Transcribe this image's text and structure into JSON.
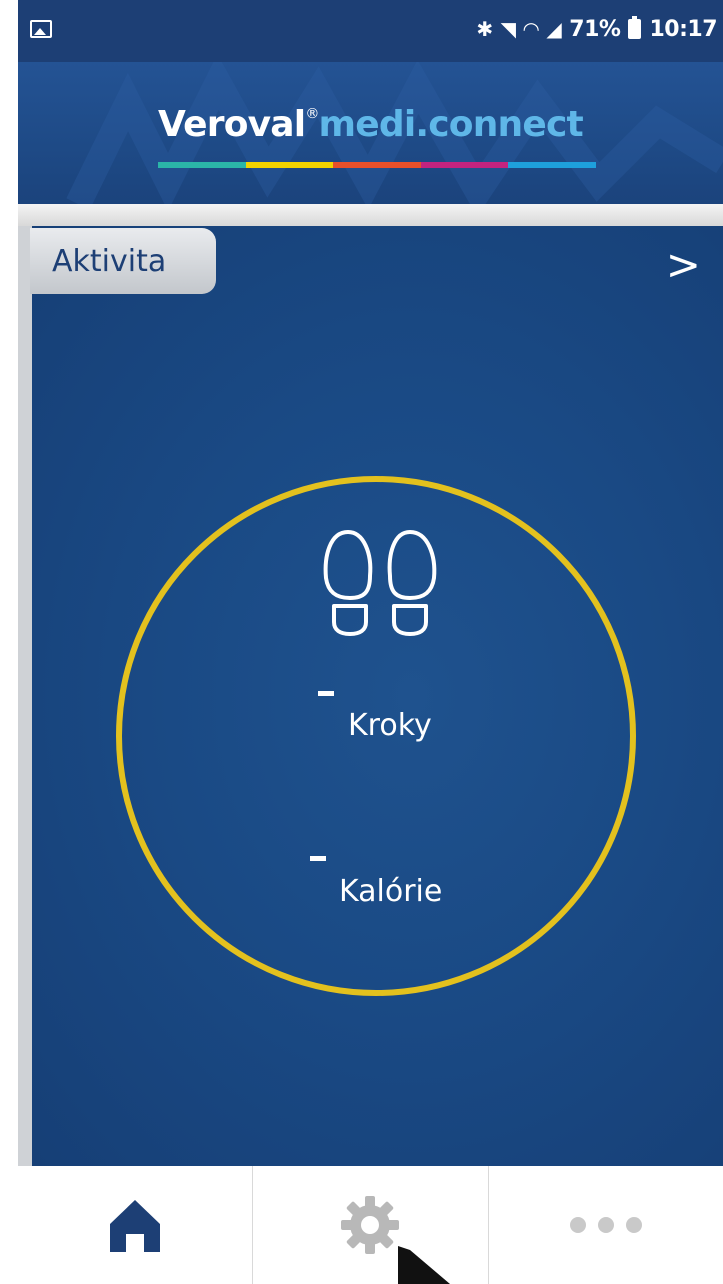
{
  "status_bar": {
    "battery": "71%",
    "time": "10:17",
    "icons": [
      "gallery-icon",
      "bluetooth-icon",
      "mute-icon",
      "wifi-icon",
      "signal-icon",
      "battery-icon"
    ]
  },
  "header": {
    "brand_part1": "Veroval",
    "brand_registered": "®",
    "brand_part2": "medi.connect",
    "color_bar": [
      "#2bb5a8",
      "#f2d200",
      "#e8502a",
      "#c3237f",
      "#1ea0dc"
    ]
  },
  "panel": {
    "tab_label": "Aktivita",
    "next_label": ">",
    "steps_value": "-",
    "steps_label": "Kroky",
    "calories_value": "-",
    "calories_label": "Kalórie",
    "ring_color": "#e3c11e"
  },
  "bottom_nav": {
    "items": [
      "home-icon",
      "settings-icon",
      "more-icon"
    ],
    "active": "home-icon"
  }
}
